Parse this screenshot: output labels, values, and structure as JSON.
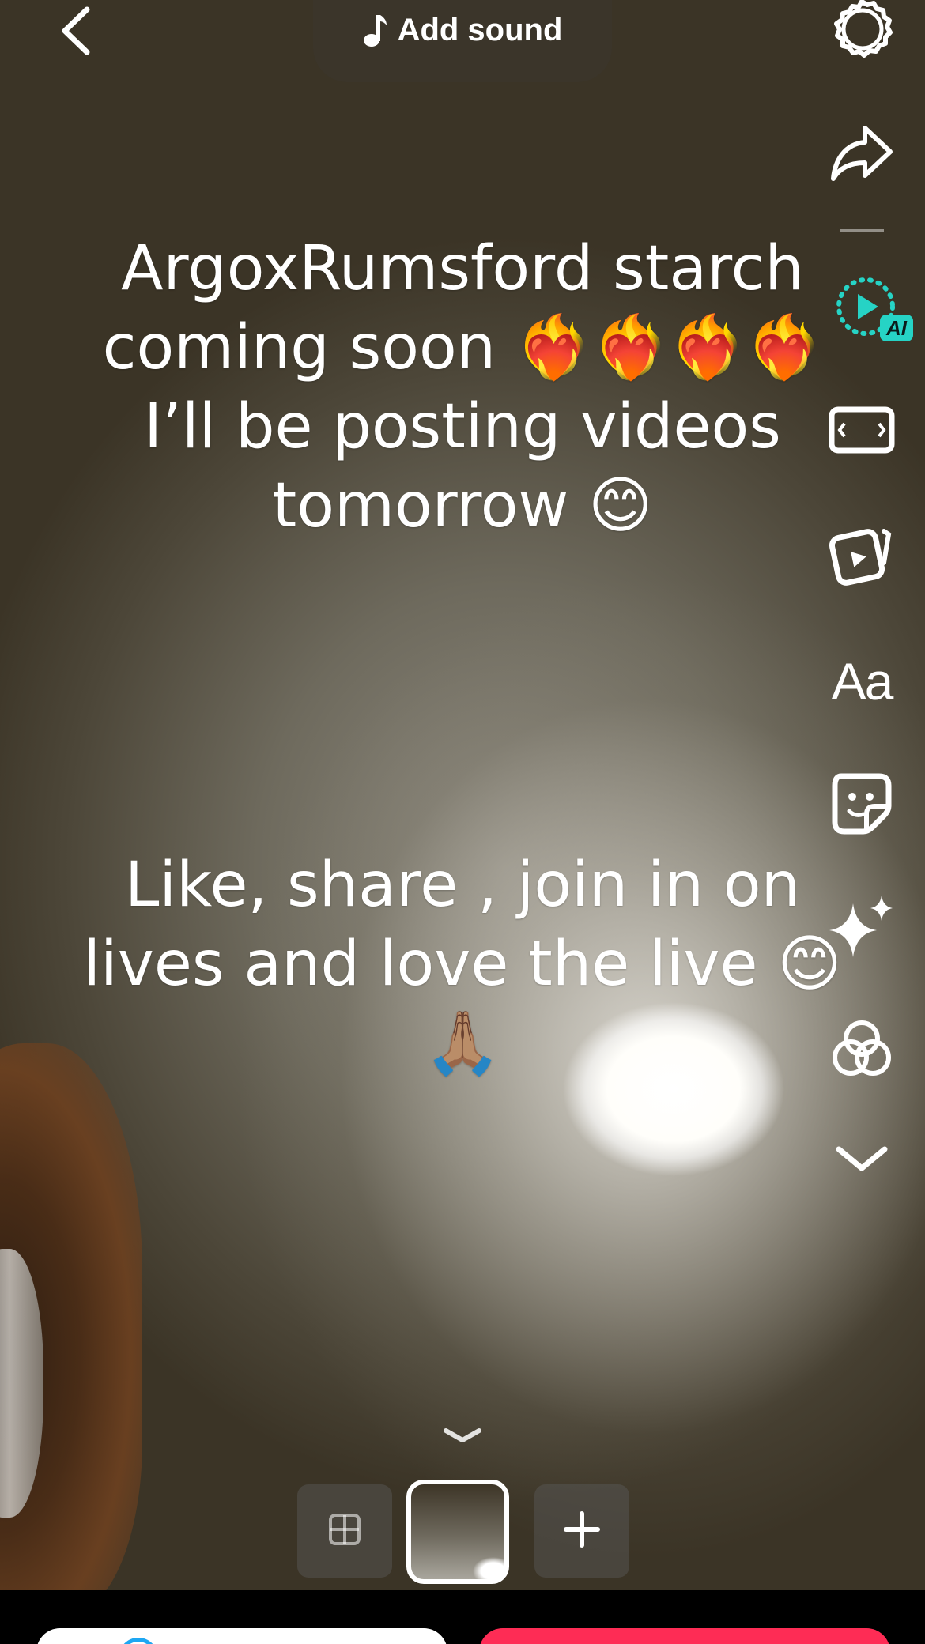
{
  "header": {
    "add_sound_label": "Add sound"
  },
  "captions": {
    "top_text": "ArgoxRumsford starch coming soon ❤️‍🔥❤️‍🔥❤️‍🔥❤️‍🔥 I’ll be posting videos tomorrow 😊",
    "bottom_text": "Like, share , join in on lives and love the live 😊🙏🏽"
  },
  "right_rail": {
    "text_tool_label": "Aa",
    "ai_badge": "AI"
  },
  "colors": {
    "accent_ai": "#26d3c5",
    "post_button": "#fe2c55",
    "story_ring": "#1ea7f2"
  },
  "icons": {
    "back": "chevron-left-icon",
    "sound": "music-note-icon",
    "settings": "settings-icon",
    "share": "share-arrow-icon",
    "ai": "ai-video-icon",
    "frame": "aspect-ratio-icon",
    "templates": "video-template-icon",
    "text": "text-icon",
    "sticker": "sticker-icon",
    "effects": "sparkle-effects-icon",
    "filters": "filters-icon",
    "more": "chevron-down-icon",
    "layout": "layout-grid-icon",
    "add": "plus-icon"
  }
}
